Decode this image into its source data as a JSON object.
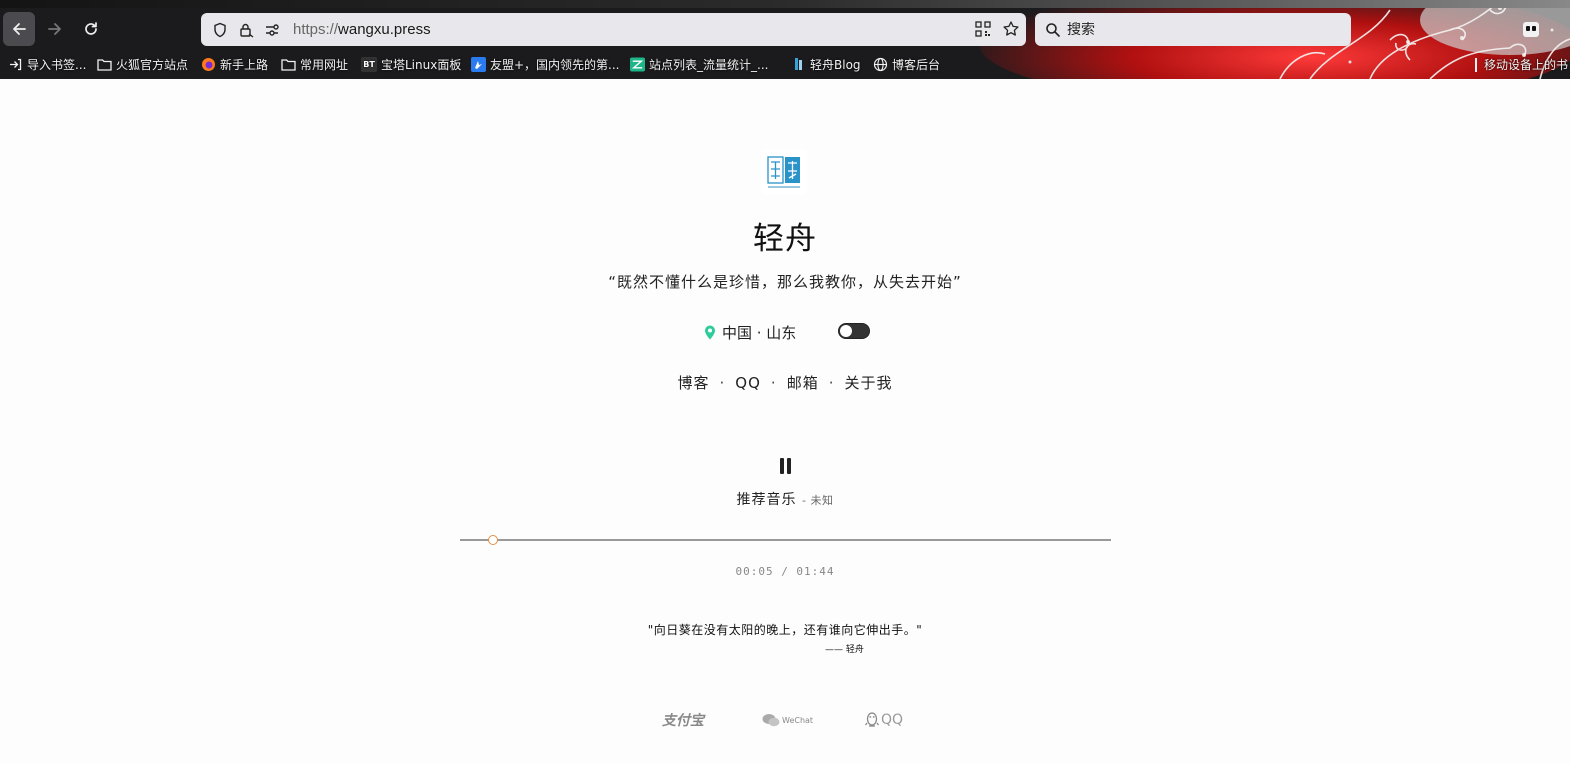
{
  "browser": {
    "url_scheme": "https://",
    "url_host": "wangxu.press",
    "search_placeholder": "搜索",
    "bookmarks": [
      {
        "label": "导入书签...",
        "icon": "import-icon"
      },
      {
        "label": "火狐官方站点",
        "icon": "folder-icon"
      },
      {
        "label": "新手上路",
        "icon": "firefox-icon"
      },
      {
        "label": "常用网址",
        "icon": "folder-icon"
      },
      {
        "label": "宝塔Linux面板",
        "icon": "bt-icon"
      },
      {
        "label": "友盟+，国内领先的第...",
        "icon": "umeng-icon"
      },
      {
        "label": "站点列表_流量统计_...",
        "icon": "cnzz-icon"
      },
      {
        "label": "轻舟Blog",
        "icon": "bookmark-icon"
      },
      {
        "label": "博客后台",
        "icon": "globe-icon"
      },
      {
        "label": "移动设备上的书",
        "icon": "mobile-icon"
      }
    ],
    "bt_badge": "BT"
  },
  "page": {
    "title": "轻舟",
    "motto": "“既然不懂什么是珍惜，那么我教你，从失去开始”",
    "location": "中国 · 山东",
    "links": [
      "博客",
      "QQ",
      "邮箱",
      "关于我"
    ],
    "player": {
      "song": "推荐音乐",
      "artist": "- 未知",
      "time": "00:05 / 01:44",
      "progress_fraction": 0.05
    },
    "quote": "\"向日葵在没有太阳的晚上，还有谁向它伸出手。\"",
    "quote_author": "—— 轻舟",
    "pay": {
      "alipay": "支付宝",
      "wechat": "WeChat",
      "qq": "QQ"
    }
  },
  "colors": {
    "accent_location": "#2ecc9a",
    "progress_thumb": "#e0904a",
    "chrome_dark": "#1b1b1d",
    "theme_art_red": "#d61f1f"
  }
}
